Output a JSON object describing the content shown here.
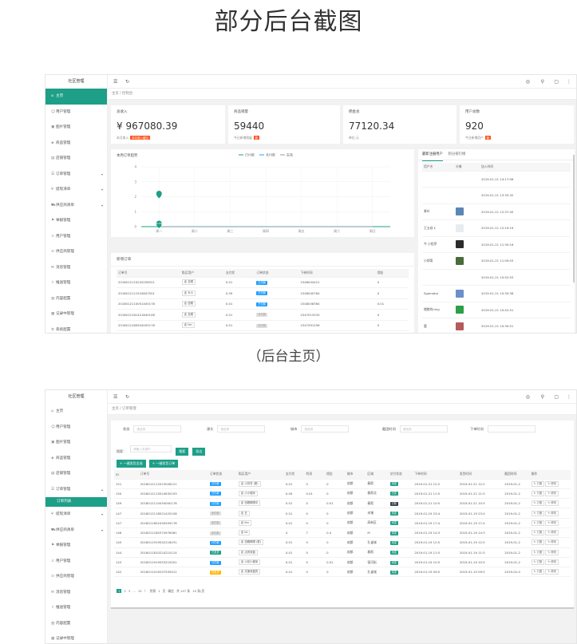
{
  "heading": "部分后台截图",
  "caption": "（后台主页）",
  "shot1": {
    "logo": "社区管理",
    "sidebar": [
      {
        "icon": "home",
        "label": "主页",
        "active": true
      },
      {
        "icon": "users",
        "label": "用户管理"
      },
      {
        "icon": "image",
        "label": "图片管理"
      },
      {
        "icon": "goods",
        "label": "商品管理"
      },
      {
        "icon": "shop",
        "label": "店铺管理"
      },
      {
        "icon": "order",
        "label": "订单管理",
        "arrow": "▾"
      },
      {
        "icon": "withdraw",
        "label": "提现清单",
        "arrow": "▾"
      },
      {
        "icon": "logistic",
        "label": "供应商清单",
        "arrow": "▾"
      },
      {
        "icon": "report",
        "label": "举报管理"
      },
      {
        "icon": "user",
        "label": "用户管理"
      },
      {
        "icon": "supply",
        "label": "供应商管理"
      },
      {
        "icon": "msg",
        "label": "消息管理"
      },
      {
        "icon": "share",
        "label": "推送管理"
      },
      {
        "icon": "content",
        "label": "内容配置"
      },
      {
        "icon": "log",
        "label": "记录中管理"
      },
      {
        "icon": "setting",
        "label": "系统配置"
      }
    ],
    "crumb": "主页 / 控制台",
    "stats": [
      {
        "label": "总收入",
        "value": "¥ 967080.39",
        "sub": "本月收入",
        "tag": "本月收入增加"
      },
      {
        "label": "商品销量",
        "value": "59440",
        "sub": "今日新增销量",
        "tag": "新"
      },
      {
        "label": "佣金总",
        "value": "77120.34",
        "sub": "单位:元",
        "tag": ""
      },
      {
        "label": "用户总数",
        "value": "920",
        "sub": "今日新增用户",
        "tag": "新"
      }
    ],
    "chart": {
      "title": "本周订单趋势",
      "legend": [
        "已付款",
        "未付款",
        "失效"
      ],
      "yticks": [
        "4",
        "3",
        "2",
        "1",
        "0"
      ],
      "xticks": [
        "周一",
        "周二",
        "周三",
        "周四",
        "周五",
        "周六",
        "周日"
      ]
    },
    "chart_data": {
      "type": "line",
      "title": "本周订单趋势",
      "categories": [
        "周一",
        "周二",
        "周三",
        "周四",
        "周五",
        "周六",
        "周日"
      ],
      "series": [
        {
          "name": "已付款",
          "values": [
            0,
            0,
            0,
            0,
            0,
            0,
            0
          ],
          "color": "#1e9f87"
        },
        {
          "name": "未付款",
          "values": [
            0,
            0,
            0,
            0,
            0,
            0,
            0
          ],
          "color": "#1e9fff"
        },
        {
          "name": "失效",
          "values": [
            0,
            0,
            0,
            0,
            0,
            0,
            0
          ],
          "color": "#999999"
        }
      ],
      "markers": [
        {
          "x": "周一",
          "y": 2,
          "label": ""
        },
        {
          "x": "周一",
          "y": 0,
          "label": "0.00"
        }
      ],
      "ylim": [
        0,
        4
      ],
      "grid": true,
      "legend_position": "top-center"
    },
    "order_table": {
      "title": "新增订单",
      "headers": [
        "订单号",
        "购买用户",
        "支付状",
        "订单状态",
        "下单时间",
        "佣金"
      ],
      "rows": [
        [
          "2018012110220256321",
          "走 丑眼",
          "0.01",
          "已付款",
          "1548044421",
          "0"
        ],
        [
          "2018012111524847501",
          "走 头小",
          "0.09",
          "已付款",
          "1548040764",
          "0"
        ],
        [
          "2018012110051400178",
          "走 伍眼",
          "0.01",
          "已付款",
          "1548038364",
          "0.01"
        ],
        [
          "2018012181421840106",
          "走 丑眼",
          "0.01",
          "未付款",
          "1547012533",
          "0"
        ],
        [
          "2018012180504005178",
          "走 fan",
          "0.01",
          "未付款",
          "1547591256",
          "0"
        ]
      ]
    },
    "user_panel": {
      "tabs": [
        "最新注册用户",
        "积分排行榜"
      ],
      "headers": [
        "用户名",
        "头像",
        "加入时间"
      ],
      "rows": [
        [
          "",
          "",
          "2019-01-21 14:17:06",
          ""
        ],
        [
          "",
          "",
          "2019-01-21 13:35:32",
          ""
        ],
        [
          "果叶",
          "",
          "2019-01-21 12:37:45",
          "#5b86b4"
        ],
        [
          "王五叔 £",
          "",
          "2019-01-21 12:19:19",
          "#e9ecef"
        ],
        [
          "今 小程序",
          "",
          "2019-01-21 11:30:16",
          "#2b2b2b"
        ],
        [
          "小胡哥",
          "",
          "2019-01-21 11:09:53",
          "#4a6b3a"
        ],
        [
          "",
          "",
          "2019-01-21 10:52:53",
          ""
        ],
        [
          "Sgamaba",
          "",
          "2019-01-21 10:30:36",
          "#6c8fc9"
        ],
        [
          "猪猪的ning",
          "",
          "2019-01-21 10:42:51",
          "#2f9e47"
        ],
        [
          "鹿",
          "",
          "2019-01-21 10:30:51",
          "#b55b5b"
        ]
      ]
    }
  },
  "shot2": {
    "logo": "社区管理",
    "sidebar": [
      {
        "icon": "home",
        "label": "主页"
      },
      {
        "icon": "users",
        "label": "用户管理"
      },
      {
        "icon": "image",
        "label": "图片管理"
      },
      {
        "icon": "goods",
        "label": "商品管理"
      },
      {
        "icon": "shop",
        "label": "店铺管理"
      },
      {
        "icon": "order",
        "label": "订单管理",
        "arrow": "▴"
      },
      {
        "icon": "sub",
        "label": "订单列表",
        "sub": true
      },
      {
        "icon": "withdraw",
        "label": "提现清单",
        "arrow": "▾"
      },
      {
        "icon": "logistic",
        "label": "供应商清单",
        "arrow": "▾"
      },
      {
        "icon": "report",
        "label": "举报管理"
      },
      {
        "icon": "user",
        "label": "用户管理"
      },
      {
        "icon": "supply",
        "label": "供应商管理"
      },
      {
        "icon": "msg",
        "label": "消息管理"
      },
      {
        "icon": "share",
        "label": "推送管理"
      },
      {
        "icon": "content",
        "label": "内容配置"
      },
      {
        "icon": "log",
        "label": "记录中管理"
      }
    ],
    "crumb": "主页 / 订单管理",
    "filters": [
      {
        "label": "状态",
        "placeholder": "请选择"
      },
      {
        "label": "源头",
        "placeholder": "请选择"
      },
      {
        "label": "城市",
        "placeholder": "请选择"
      },
      {
        "label": "截团时间",
        "placeholder": "请选择"
      },
      {
        "label": "下单时间",
        "placeholder": ""
      }
    ],
    "search": {
      "label": "搜索：",
      "placeholder": "请输入关键字",
      "btn": "搜索",
      "btn2": "导出"
    },
    "actions": [
      "+ 一键发货全选",
      "+ 一键发货订单"
    ],
    "headers": [
      "ID",
      "订单号",
      "订单状态",
      "购买用户",
      "支付状",
      "利润",
      "佣金",
      "城市",
      "区域",
      "交付状态",
      "下单时间",
      "发货时间",
      "截团时间",
      "操作"
    ],
    "rows": [
      [
        "151",
        "2018012112023028121",
        "已付款",
        "走 小芳芳 (更)",
        "0.01",
        "0",
        "0",
        "成都",
        "春熙",
        "未发",
        "2019-01-21 12:2",
        "2019-01-21 12:2",
        "2019-01-2",
        "blue"
      ],
      [
        "150",
        "2018012115024630193",
        "已付款",
        "走 小小程序",
        "0.09",
        "0.01",
        "0",
        "成都",
        "春熙北",
        "已发",
        "2019-01-21 11:5",
        "2019-01-21 11:5",
        "2019-01-2",
        "blue"
      ],
      [
        "149",
        "2018012110054000178",
        "已付款",
        "走 伍眼睛眼中",
        "0.01",
        "0",
        "0.01",
        "成都",
        "春熙",
        "已收",
        "2019-01-21 10:5",
        "2019-01-21 10:5",
        "2019-01-2",
        "blue"
      ],
      [
        "147",
        "2018012118521425108",
        "未付款",
        "走 丑",
        "0.01",
        "0",
        "0",
        "成都",
        "米铺",
        "未发",
        "2019-01-19 23:4",
        "2019-01-19 23:4",
        "2019-01-2",
        "grey"
      ],
      [
        "147",
        "2018011802450509178",
        "未付款",
        "走 fan",
        "0.01",
        "0",
        "0",
        "成都",
        "高新区",
        "未发",
        "2019-01-19 17:4",
        "2019-01-19 17:4",
        "2019-01-2",
        "grey"
      ],
      [
        "146",
        "2018011180374976081",
        "未付款",
        "走 ldi",
        "4",
        "7",
        "0.4",
        "成都",
        "M",
        "未发",
        "2019-01-19 14:3",
        "2019-01-19 14:3",
        "2019-01-2",
        "grey"
      ],
      [
        "145",
        "2018011919542216031",
        "已付款",
        "走 伍眼睛眼 (更)",
        "0.01",
        "0",
        "0",
        "成都",
        "孔雀城",
        "未发",
        "2019-01-19 12:5",
        "2019-01-19 12:5",
        "2019-01-2",
        "blue"
      ],
      [
        "144",
        "2018011810224215124",
        "已发货",
        "走 点亮深蓝",
        "0.01",
        "0",
        "0",
        "成都",
        "春熙",
        "未发",
        "2019-01-19 11:5",
        "2019-01-19 11:5",
        "2019-01-2",
        "green"
      ],
      [
        "143",
        "2018011919553219201",
        "已付款",
        "走 小花小程序",
        "0.01",
        "0",
        "0.01",
        "成都",
        "银河街",
        "未发",
        "2019-01-19 10:5",
        "2019-01-19 10:5",
        "2019-01-2",
        "blue"
      ],
      [
        "142",
        "2018011019257550912",
        "待发货",
        "走 光速深蓝的",
        "0.01",
        "0",
        "0",
        "成都",
        "孔雀城",
        "未发",
        "2019-01-19 09:5",
        "2019-01-19 09:5",
        "2019-02-0",
        "orange"
      ]
    ],
    "op_buttons": [
      "↻ 订团",
      "✎ 修改"
    ],
    "pager": {
      "pages": [
        "1",
        "2",
        "3",
        "...",
        "15",
        "〉",
        "到第",
        "1",
        "页",
        "确定"
      ],
      "total": "共 147 条",
      "per": "10 条/页"
    }
  }
}
